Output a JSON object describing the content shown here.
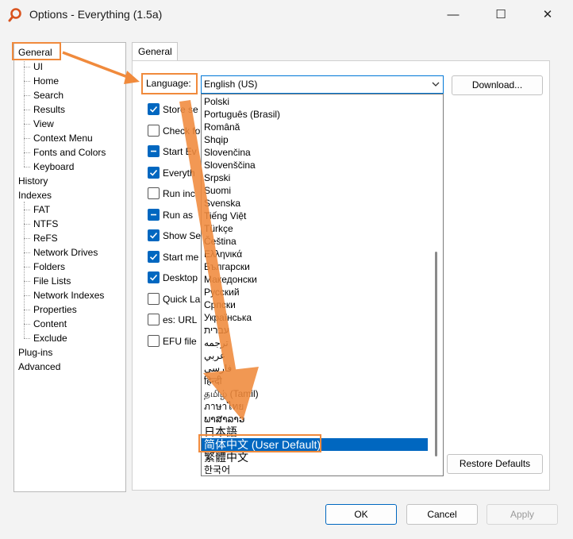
{
  "window": {
    "title": "Options - Everything (1.5a)",
    "minimize_glyph": "—",
    "maximize_glyph": "☐",
    "close_glyph": "✕",
    "icon": "magnifier-icon"
  },
  "tree": [
    {
      "label": "General",
      "level": 0
    },
    {
      "label": "UI",
      "level": 1
    },
    {
      "label": "Home",
      "level": 1
    },
    {
      "label": "Search",
      "level": 1
    },
    {
      "label": "Results",
      "level": 1
    },
    {
      "label": "View",
      "level": 1
    },
    {
      "label": "Context Menu",
      "level": 1
    },
    {
      "label": "Fonts and Colors",
      "level": 1
    },
    {
      "label": "Keyboard",
      "level": 1
    },
    {
      "label": "History",
      "level": 0
    },
    {
      "label": "Indexes",
      "level": 0
    },
    {
      "label": "FAT",
      "level": 1
    },
    {
      "label": "NTFS",
      "level": 1
    },
    {
      "label": "ReFS",
      "level": 1
    },
    {
      "label": "Network Drives",
      "level": 1
    },
    {
      "label": "Folders",
      "level": 1
    },
    {
      "label": "File Lists",
      "level": 1
    },
    {
      "label": "Network Indexes",
      "level": 1
    },
    {
      "label": "Properties",
      "level": 1
    },
    {
      "label": "Content",
      "level": 1
    },
    {
      "label": "Exclude",
      "level": 1
    },
    {
      "label": "Plug-ins",
      "level": 0
    },
    {
      "label": "Advanced",
      "level": 0
    }
  ],
  "tab": {
    "label": "General"
  },
  "language": {
    "label": "Language:",
    "value": "English (US)"
  },
  "download_button": "Download...",
  "restore_button": "Restore Defaults",
  "checkboxes": [
    {
      "label": "Store se",
      "state": "checked"
    },
    {
      "label": "Check fo",
      "state": "unchecked"
    },
    {
      "label": "Start Ev",
      "state": "mixed"
    },
    {
      "label": "Everyth",
      "state": "checked"
    },
    {
      "label": "Run inc",
      "state": "unchecked"
    },
    {
      "label": "Run as",
      "state": "mixed"
    },
    {
      "label": "Show Se",
      "state": "checked"
    },
    {
      "label": "Start me",
      "state": "checked"
    },
    {
      "label": "Desktop",
      "state": "checked"
    },
    {
      "label": "Quick La",
      "state": "unchecked"
    },
    {
      "label": "es: URL",
      "state": "unchecked"
    },
    {
      "label": "EFU file",
      "state": "unchecked"
    }
  ],
  "language_options": [
    {
      "label": "Polski"
    },
    {
      "label": "Português (Brasil)"
    },
    {
      "label": "Română"
    },
    {
      "label": "Shqip"
    },
    {
      "label": "Slovenčina"
    },
    {
      "label": "Slovenščina"
    },
    {
      "label": "Srpski"
    },
    {
      "label": "Suomi"
    },
    {
      "label": "Svenska"
    },
    {
      "label": "Tiếng Việt"
    },
    {
      "label": "Türkçe"
    },
    {
      "label": "Čeština"
    },
    {
      "label": "Ελληνικά"
    },
    {
      "label": "Български"
    },
    {
      "label": "Македонски"
    },
    {
      "label": "Русский"
    },
    {
      "label": "Српски"
    },
    {
      "label": "Українська"
    },
    {
      "label": "עברית"
    },
    {
      "label": "ترجمه"
    },
    {
      "label": "عربي"
    },
    {
      "label": "فارسی"
    },
    {
      "label": "हिन्दी"
    },
    {
      "label": "தமிழ் (Tamil)"
    },
    {
      "label": "ภาษาไทย"
    },
    {
      "label": "ພາສາລາວ"
    },
    {
      "label": "日本語",
      "big": true
    },
    {
      "label": "简体中文 (User Default)",
      "big": true,
      "selected": true
    },
    {
      "label": "繁體中文",
      "big": true
    },
    {
      "label": "한국어"
    }
  ],
  "footer": {
    "ok": "OK",
    "cancel": "Cancel",
    "apply": "Apply"
  },
  "colors": {
    "accent": "#0067c0",
    "annotation": "#f08a3c"
  }
}
